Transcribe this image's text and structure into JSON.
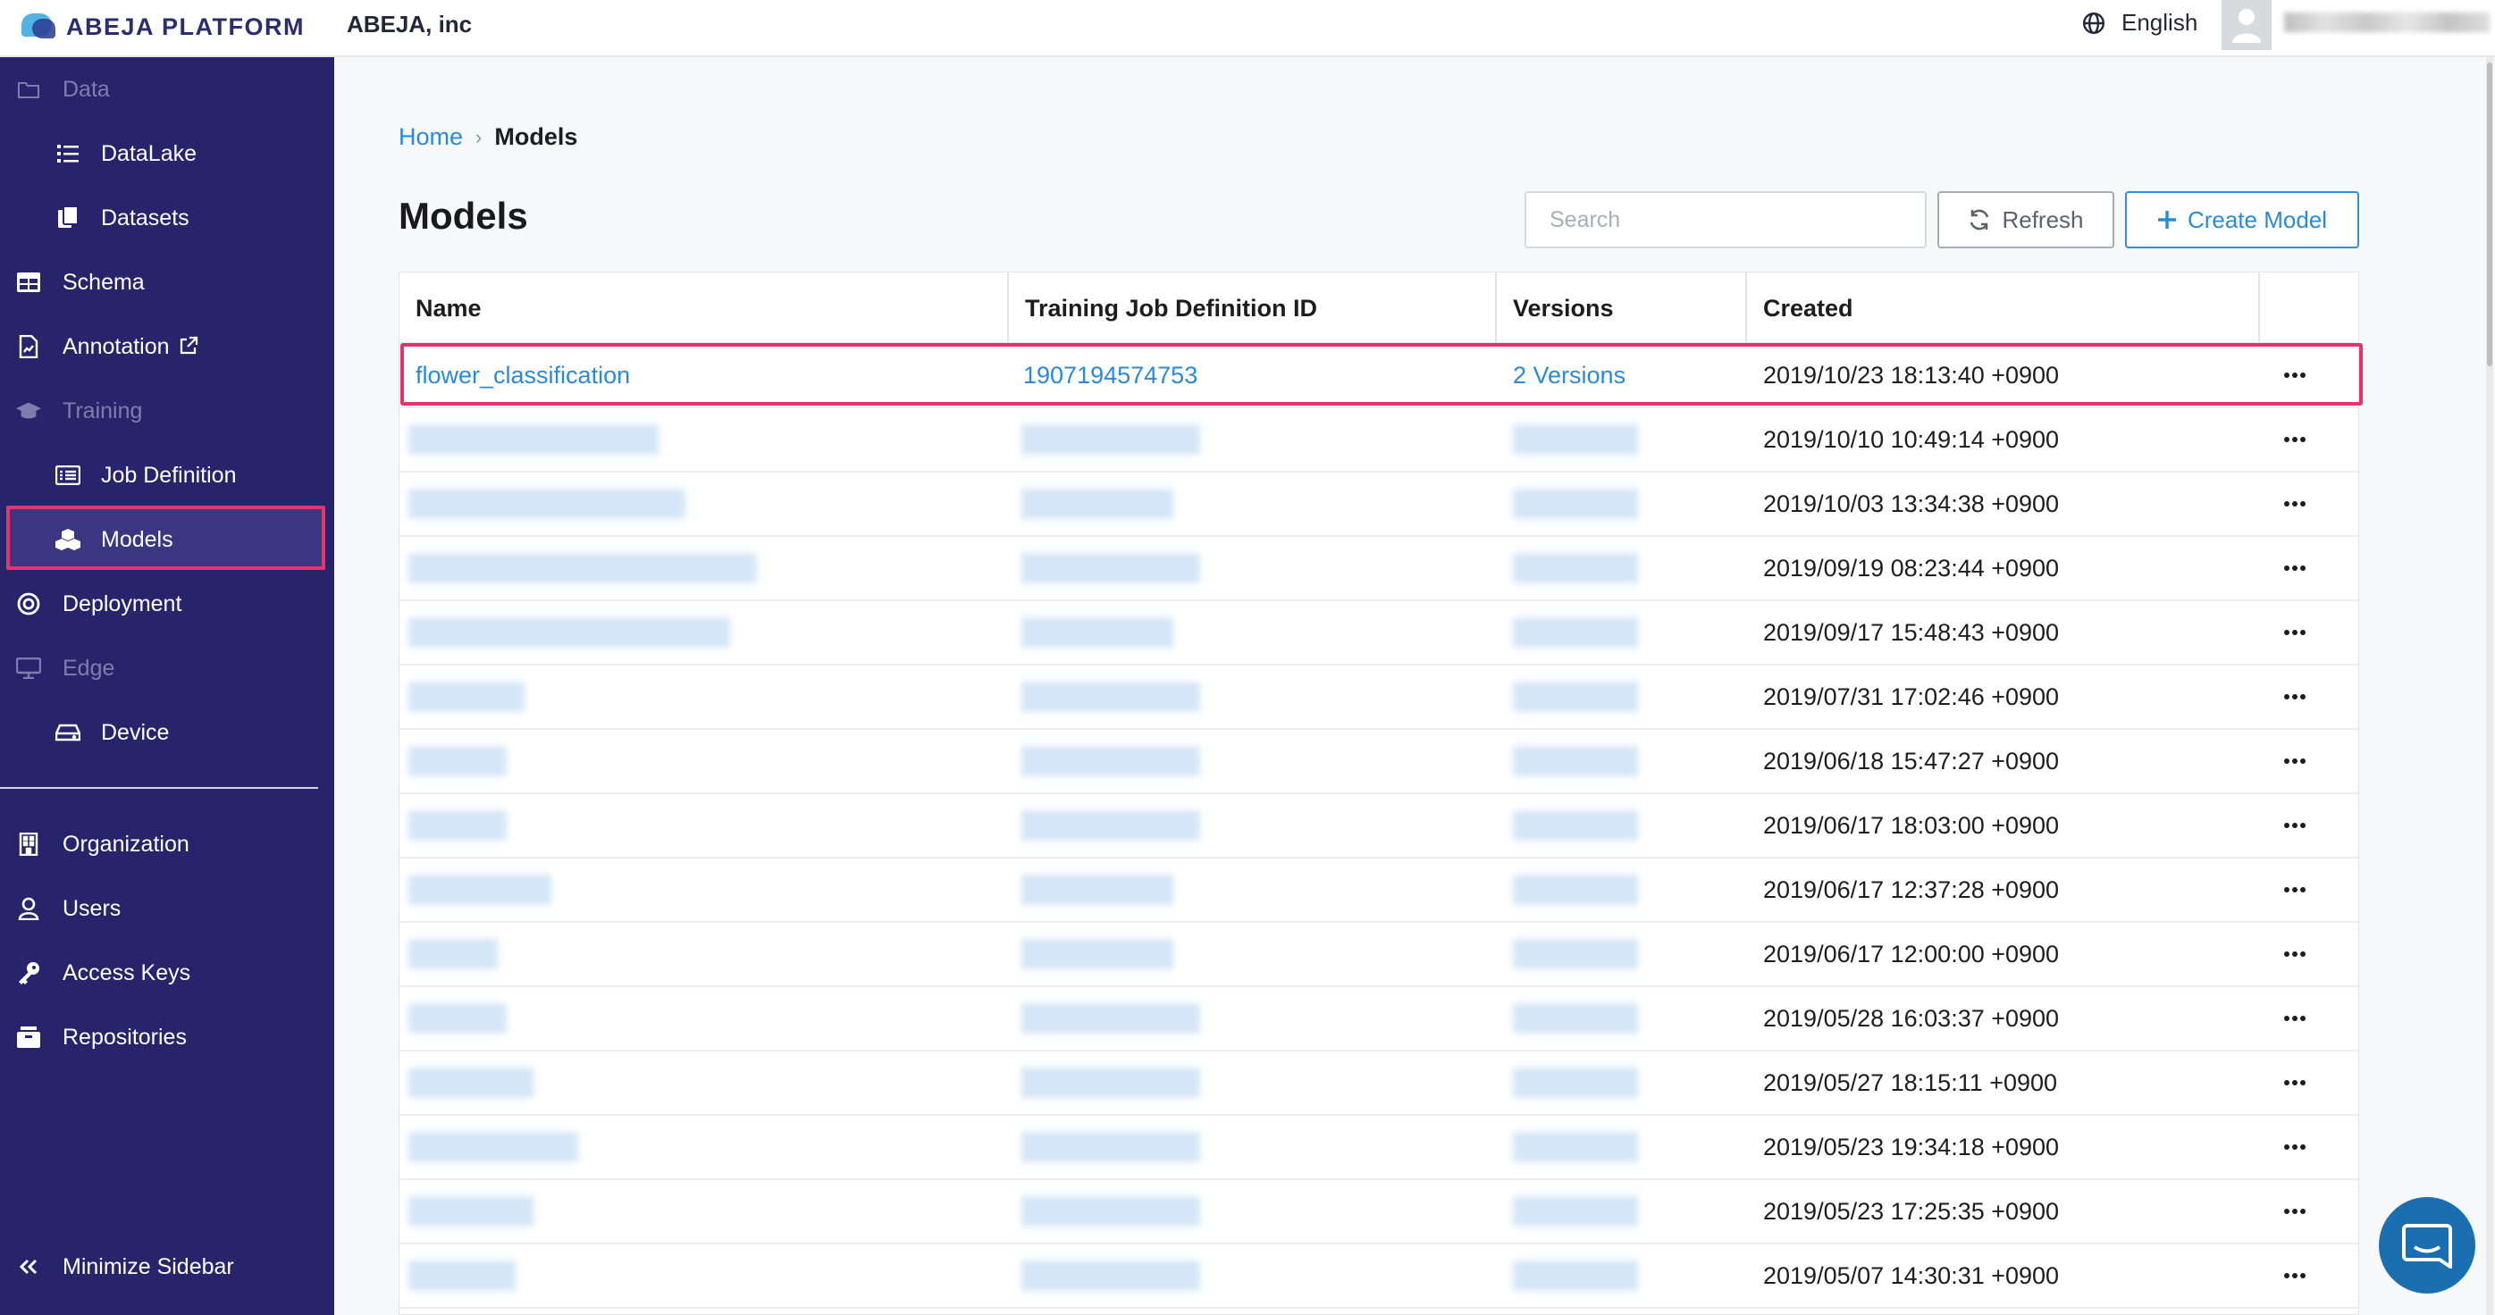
{
  "app": {
    "logo_text": "ABEJA PLATFORM",
    "org_name": "ABEJA, inc",
    "language": "English",
    "brand_color": "#28246b",
    "accent_color": "#2b8ad6",
    "highlight_color": "#e4346b"
  },
  "sidebar": {
    "items": [
      {
        "label": "Data",
        "icon": "folder-icon",
        "kind": "section"
      },
      {
        "label": "DataLake",
        "icon": "list-icon",
        "kind": "sub"
      },
      {
        "label": "Datasets",
        "icon": "files-icon",
        "kind": "sub"
      },
      {
        "label": "Schema",
        "icon": "table-icon",
        "kind": "top"
      },
      {
        "label": "Annotation",
        "icon": "file-chart-icon",
        "kind": "top",
        "external": "external-link-icon"
      },
      {
        "label": "Training",
        "icon": "graduation-cap-icon",
        "kind": "section"
      },
      {
        "label": "Job Definition",
        "icon": "list-box-icon",
        "kind": "sub"
      },
      {
        "label": "Models",
        "icon": "cubes-icon",
        "kind": "sub",
        "active": true
      },
      {
        "label": "Deployment",
        "icon": "target-icon",
        "kind": "top"
      },
      {
        "label": "Edge",
        "icon": "monitor-icon",
        "kind": "section"
      },
      {
        "label": "Device",
        "icon": "hdd-icon",
        "kind": "sub"
      },
      {
        "label": "Organization",
        "icon": "building-icon",
        "kind": "top"
      },
      {
        "label": "Users",
        "icon": "user-icon",
        "kind": "top"
      },
      {
        "label": "Access Keys",
        "icon": "key-icon",
        "kind": "top"
      },
      {
        "label": "Repositories",
        "icon": "repository-icon",
        "kind": "top"
      }
    ],
    "minimize_label": "Minimize Sidebar"
  },
  "breadcrumb": {
    "home": "Home",
    "separator": "›",
    "current": "Models"
  },
  "page": {
    "title": "Models"
  },
  "toolbar": {
    "search_placeholder": "Search",
    "refresh_label": "Refresh",
    "create_label": "Create Model"
  },
  "table": {
    "columns": [
      "Name",
      "Training Job Definition ID",
      "Versions",
      "Created"
    ],
    "rows": [
      {
        "name": "flower_classification",
        "job_definition_id": "1907194574753",
        "versions": "2 Versions",
        "created": "2019/10/23 18:13:40 +0900",
        "highlighted": true
      },
      {
        "created": "2019/10/10 10:49:14 +0900"
      },
      {
        "created": "2019/10/03 13:34:38 +0900"
      },
      {
        "created": "2019/09/19 08:23:44 +0900"
      },
      {
        "created": "2019/09/17 15:48:43 +0900"
      },
      {
        "created": "2019/07/31 17:02:46 +0900"
      },
      {
        "created": "2019/06/18 15:47:27 +0900"
      },
      {
        "created": "2019/06/17 18:03:00 +0900"
      },
      {
        "created": "2019/06/17 12:37:28 +0900"
      },
      {
        "created": "2019/06/17 12:00:00 +0900"
      },
      {
        "created": "2019/05/28 16:03:37 +0900"
      },
      {
        "created": "2019/05/27 18:15:11 +0900"
      },
      {
        "created": "2019/05/23 19:34:18 +0900"
      },
      {
        "created": "2019/05/23 17:25:35 +0900"
      },
      {
        "created": "2019/05/07 14:30:31 +0900"
      }
    ]
  }
}
